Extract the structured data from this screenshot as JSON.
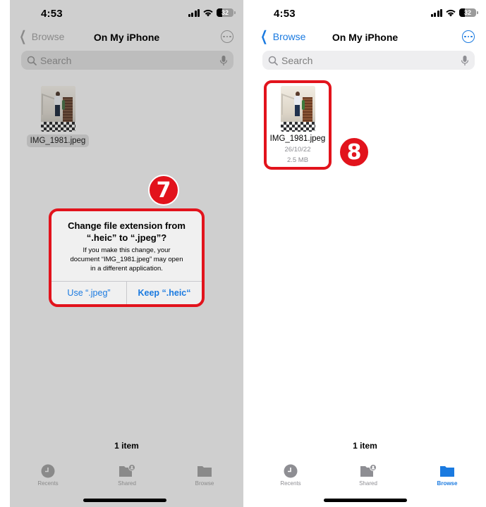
{
  "left_screen": {
    "status": {
      "time": "4:53",
      "battery": "32"
    },
    "nav": {
      "back_label": "Browse",
      "title": "On My iPhone"
    },
    "search": {
      "placeholder": "Search"
    },
    "file": {
      "name": "IMG_1981.jpeg"
    },
    "dialog": {
      "title_line1": "Change file extension from",
      "title_line2": "“.heic” to “.jpeg”?",
      "message_line1": "If you make this change, your",
      "message_line2": "document “IMG_1981.jpeg” may open",
      "message_line3": "in a different application.",
      "secondary_button": "Use “.jpeg”",
      "primary_button": "Keep “.heic“"
    },
    "step_badge": "7",
    "item_count": "1 item",
    "tabs": [
      {
        "label": "Recents",
        "icon": "clock-icon",
        "active": false
      },
      {
        "label": "Shared",
        "icon": "shared-folder-icon",
        "active": false
      },
      {
        "label": "Browse",
        "icon": "folder-icon",
        "active": false
      }
    ]
  },
  "right_screen": {
    "status": {
      "time": "4:53",
      "battery": "32"
    },
    "nav": {
      "back_label": "Browse",
      "title": "On My iPhone"
    },
    "search": {
      "placeholder": "Search"
    },
    "file": {
      "name": "IMG_1981.jpeg",
      "date": "26/10/22",
      "size": "2.5 MB"
    },
    "step_badge": "8",
    "item_count": "1 item",
    "tabs": [
      {
        "label": "Recents",
        "icon": "clock-icon",
        "active": false
      },
      {
        "label": "Shared",
        "icon": "shared-folder-icon",
        "active": false
      },
      {
        "label": "Browse",
        "icon": "folder-icon",
        "active": true
      }
    ]
  },
  "colors": {
    "accent_blue": "#1a7ae0",
    "highlight_red": "#e2131c",
    "dim_overlay": "#cfcfcf"
  }
}
